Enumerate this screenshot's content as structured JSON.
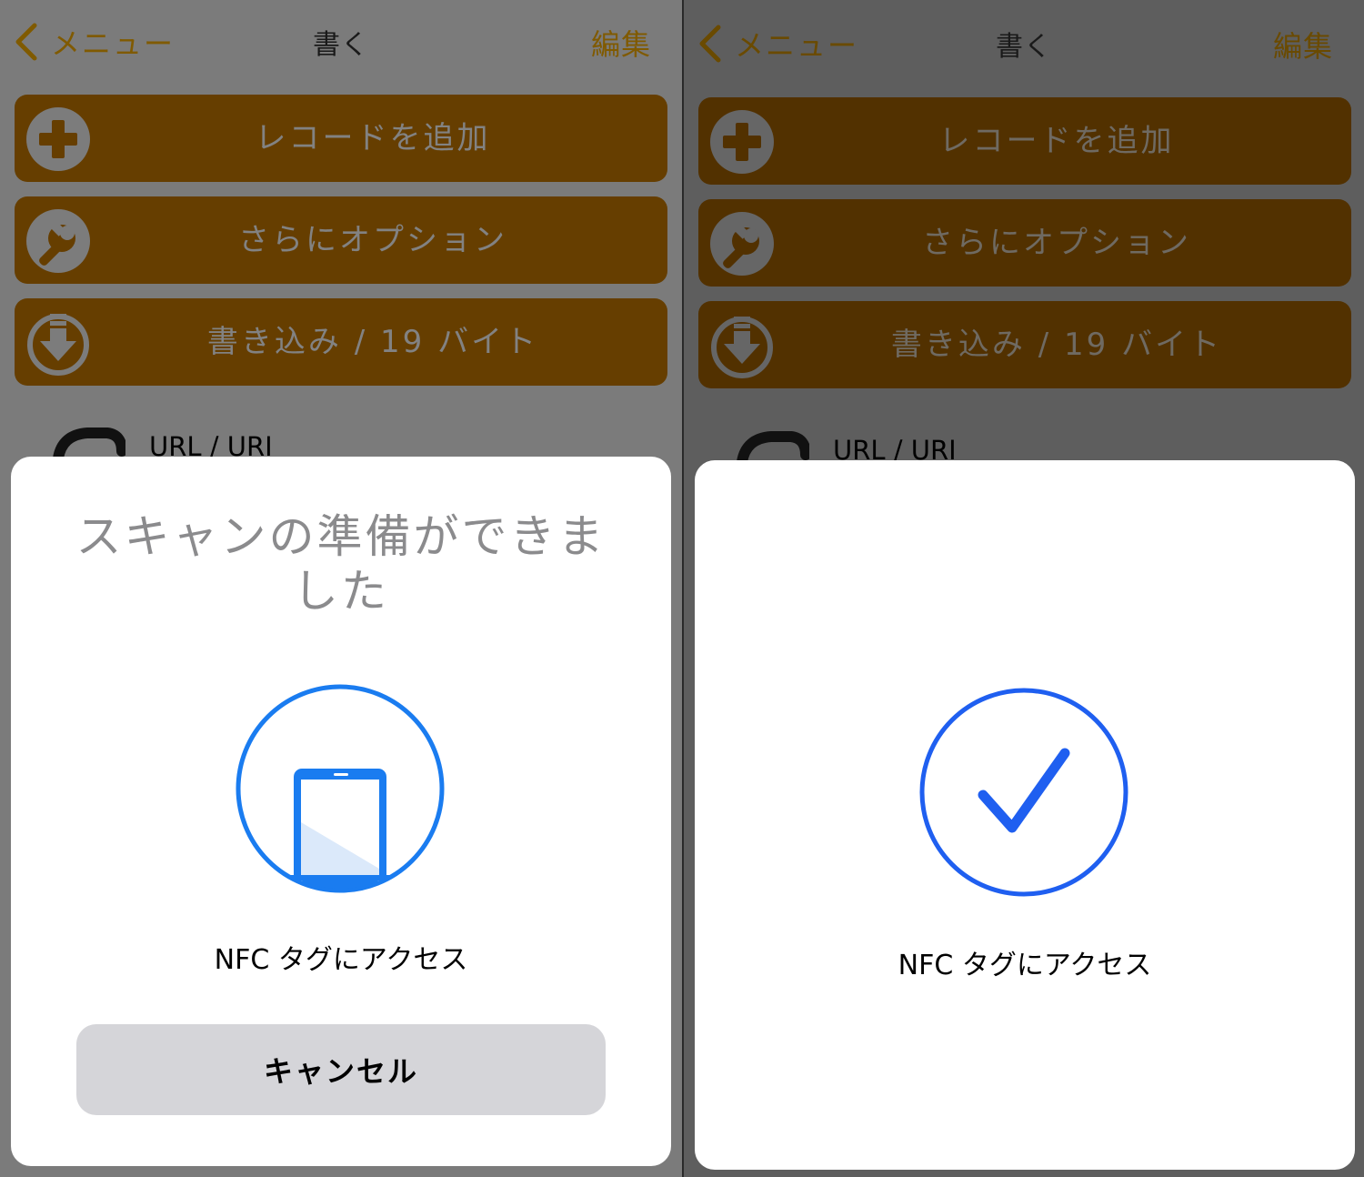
{
  "screens": [
    {
      "nav": {
        "back_label": "メニュー",
        "title": "書く",
        "edit_label": "編集"
      },
      "buttons": [
        {
          "label": "レコードを追加",
          "icon": "plus-circle-icon"
        },
        {
          "label": "さらにオプション",
          "icon": "wrench-icon"
        },
        {
          "label": "書き込み / 19 バイト",
          "icon": "download-icon"
        }
      ],
      "record": {
        "label": "URL / URI",
        "icon": "link-icon"
      },
      "sheet": {
        "title": "スキャンの準備ができました",
        "message": "NFC タグにアクセス",
        "cancel_label": "キャンセル",
        "graphic": "phone-scan-icon"
      }
    },
    {
      "nav": {
        "back_label": "メニュー",
        "title": "書く",
        "edit_label": "編集"
      },
      "buttons": [
        {
          "label": "レコードを追加",
          "icon": "plus-circle-icon"
        },
        {
          "label": "さらにオプション",
          "icon": "wrench-icon"
        },
        {
          "label": "書き込み / 19 バイト",
          "icon": "download-icon"
        }
      ],
      "record": {
        "label": "URL / URI",
        "icon": "link-icon"
      },
      "sheet": {
        "message": "NFC タグにアクセス",
        "graphic": "checkmark-circle-icon"
      }
    }
  ],
  "colors": {
    "accent": "#805a00",
    "button_left": "#663e00",
    "button_right": "#523100",
    "nfc_blue": "#1a7cf0",
    "check_blue": "#1f5ff0"
  }
}
